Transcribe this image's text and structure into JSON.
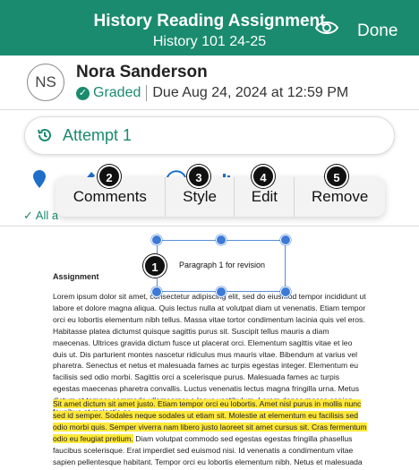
{
  "header": {
    "title": "History Reading Assignment",
    "subtitle": "History 101 24-25",
    "eye_icon": "eye-icon",
    "done_label": "Done",
    "background_color": "#1a8b6e"
  },
  "student": {
    "initials": "NS",
    "name": "Nora Sanderson",
    "status": "Graded",
    "due": "Due Aug 24, 2024 at 12:59 PM"
  },
  "attempt": {
    "label": "Attempt 1",
    "icon": "history-icon"
  },
  "toolbar": {
    "all_label": "All a"
  },
  "menu": {
    "items": [
      "Comments",
      "Style",
      "Edit",
      "Remove"
    ]
  },
  "callouts": [
    "1",
    "2",
    "3",
    "4",
    "5"
  ],
  "annotation": {
    "text": "Paragraph 1 for revision"
  },
  "document": {
    "heading": "Assignment",
    "paragraph1": "Lorem ipsum dolor sit amet, consectetur adipiscing elit, sed do eiusmod tempor incididunt ut labore et dolore magna aliqua. Quis lectus nulla at volutpat diam ut venenatis. Etiam tempor orci eu lobortis elementum nibh tellus. Massa vitae tortor condimentum lacinia quis vel eros. Habitasse platea dictumst quisque sagittis purus sit. Suscipit tellus mauris a diam maecenas. Ultrices gravida dictum fusce ut placerat orci. Elementum sagittis vitae et leo duis ut. Dis parturient montes nascetur ridiculus mus mauris vitae. Bibendum at varius vel pharetra. Senectus et netus et malesuada fames ac turpis egestas integer. Elementum eu facilisis sed odio morbi. Sagittis orci a scelerisque purus. Malesuada fames ac turpis egestas maecenas pharetra convallis. Luctus venenatis lectus magna fringilla urna. Metus dictum at tempor commodo ullamcorper a lacus vestibulum. Lorem donec massa sapien faucibus et molestie ac.",
    "paragraph2_highlighted": "Sit amet dictum sit amet justo. Etiam tempor orci eu lobortis. Amet nisl purus in mollis nunc sed id semper. Sodales neque sodales ut etiam sit. Molestie at elementum eu facilisis sed odio morbi quis. Semper viverra nam libero justo laoreet sit amet cursus sit. Cras fermentum odio eu feugiat pretium.",
    "paragraph2_rest": " Diam volutpat commodo sed egestas egestas fringilla phasellus faucibus scelerisque. Erat imperdiet sed euismod nisi. Id venenatis a condimentum vitae sapien pellentesque habitant. Tempor orci eu lobortis elementum nibh. Netus et malesuada fames ac.",
    "highlight_color": "#ffe83a"
  }
}
